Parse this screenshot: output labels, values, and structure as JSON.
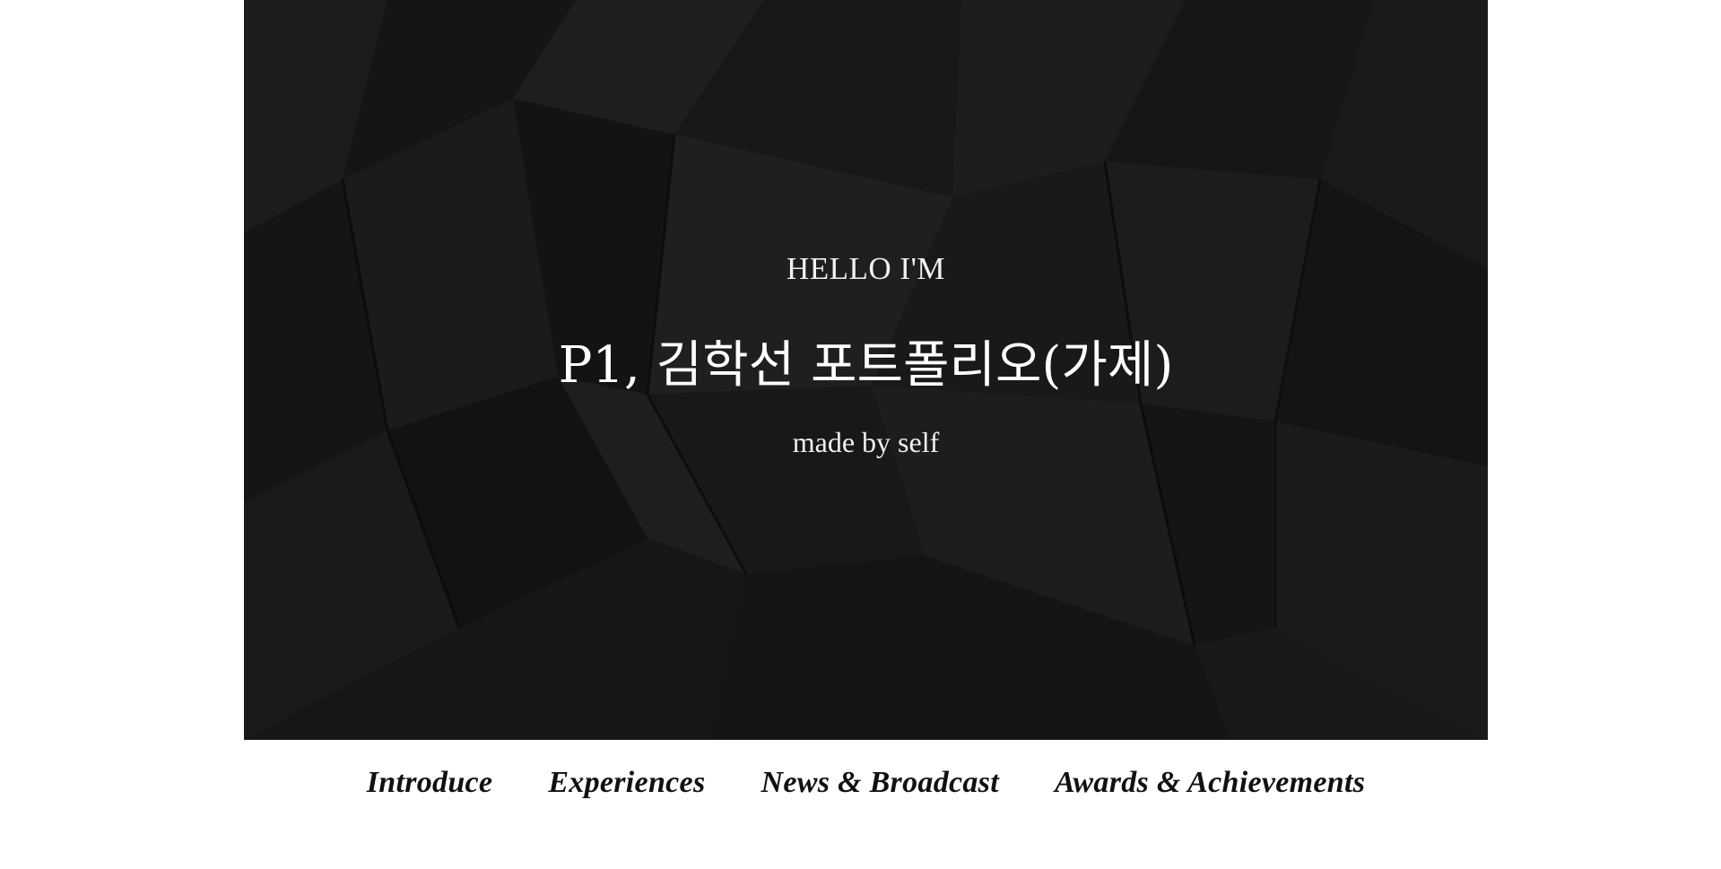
{
  "hero": {
    "greeting": "HELLO I'M",
    "title": "P1, 김학선 포트폴리오(가제)",
    "subtitle": "made by self",
    "background_color": "#171717",
    "text_color": "#ffffff"
  },
  "nav": {
    "items": [
      {
        "label": "Introduce"
      },
      {
        "label": "Experiences"
      },
      {
        "label": "News & Broadcast"
      },
      {
        "label": "Awards & Achievements"
      }
    ],
    "text_color": "#111111"
  },
  "page": {
    "background_color": "#ffffff"
  }
}
